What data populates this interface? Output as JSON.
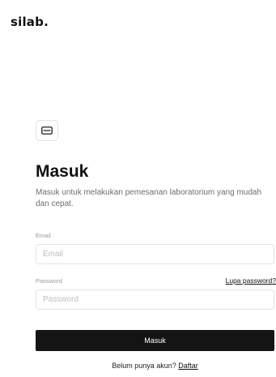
{
  "brand": {
    "logo_text": "silab."
  },
  "login": {
    "icon": "keyboard-icon",
    "title": "Masuk",
    "subtitle": "Masuk untuk melakukan pemesanan laboratorium yang mudah dan cepat.",
    "email": {
      "label": "Email",
      "placeholder": "Email",
      "value": ""
    },
    "password": {
      "label": "Password",
      "placeholder": "Password",
      "value": "",
      "forgot_link": "Lupa password?"
    },
    "submit_label": "Masuk",
    "signup_prompt": "Belum punya akun?",
    "signup_link": "Daftar"
  },
  "colors": {
    "primary_button": "#141414",
    "input_border": "#e3e3e3",
    "muted_text": "#6d6d6d"
  }
}
